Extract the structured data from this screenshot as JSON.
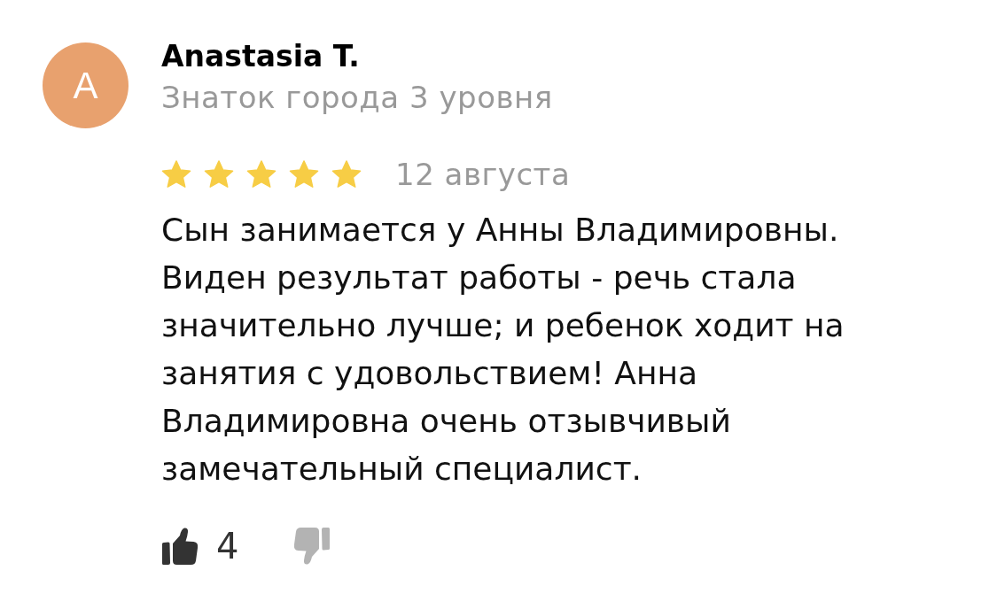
{
  "review": {
    "author": {
      "avatar_letter": "A",
      "name": "Anastasia T.",
      "rank": "Знаток города 3 уровня"
    },
    "stars": 5,
    "date": "12 августа",
    "text": "Сын занимается у Анны Владимировны. Виден результат работы - речь стала значительно лучше; и ребенок ходит на занятия с удовольствием! Анна Владимировна очень отзывчивый замечательный специалист.",
    "reactions": [
      {
        "kind": "like",
        "count": "4",
        "selected": true
      },
      {
        "kind": "dislike",
        "selected": false
      }
    ]
  }
}
